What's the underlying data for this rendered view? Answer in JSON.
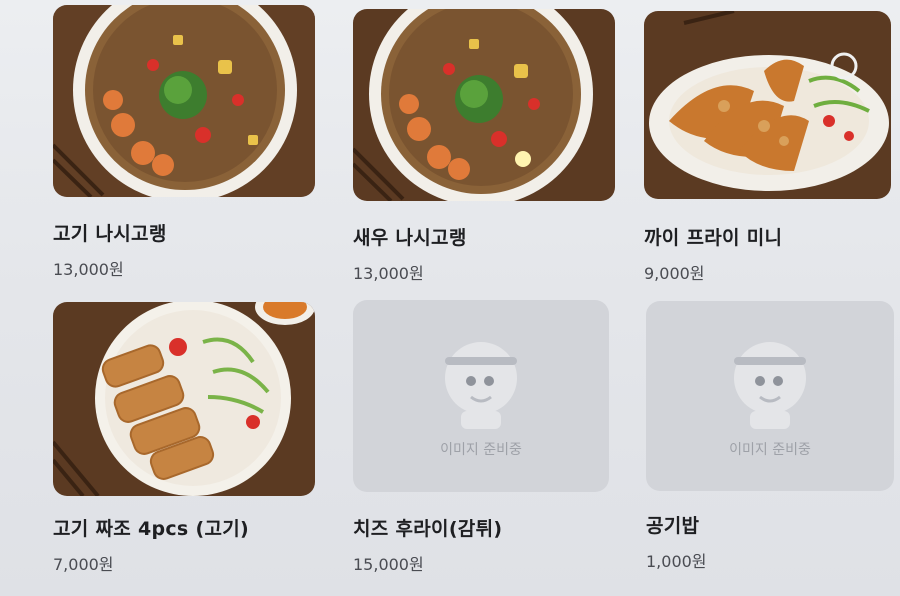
{
  "menu": [
    {
      "name": "고기 나시고랭",
      "price": "13,000원",
      "image": "fried-rice-bowl"
    },
    {
      "name": "새우 나시고랭",
      "price": "13,000원",
      "image": "fried-rice-bowl"
    },
    {
      "name": "까이 프라이 미니",
      "price": "9,000원",
      "image": "fried-chicken-plate"
    },
    {
      "name": "고기 짜조 4pcs (고기)",
      "price": "7,000원",
      "image": "spring-rolls-plate"
    },
    {
      "name": "치즈 후라이(감튀)",
      "price": "15,000원",
      "image": "placeholder"
    },
    {
      "name": "공기밥",
      "price": "1,000원",
      "image": "placeholder"
    }
  ],
  "placeholder_text": "이미지 준비중",
  "colors": {
    "wood": "#5b3a22",
    "plate": "#f4f1ea",
    "rice": "#8a6238",
    "placeholder_bg": "#d2d4d9"
  }
}
